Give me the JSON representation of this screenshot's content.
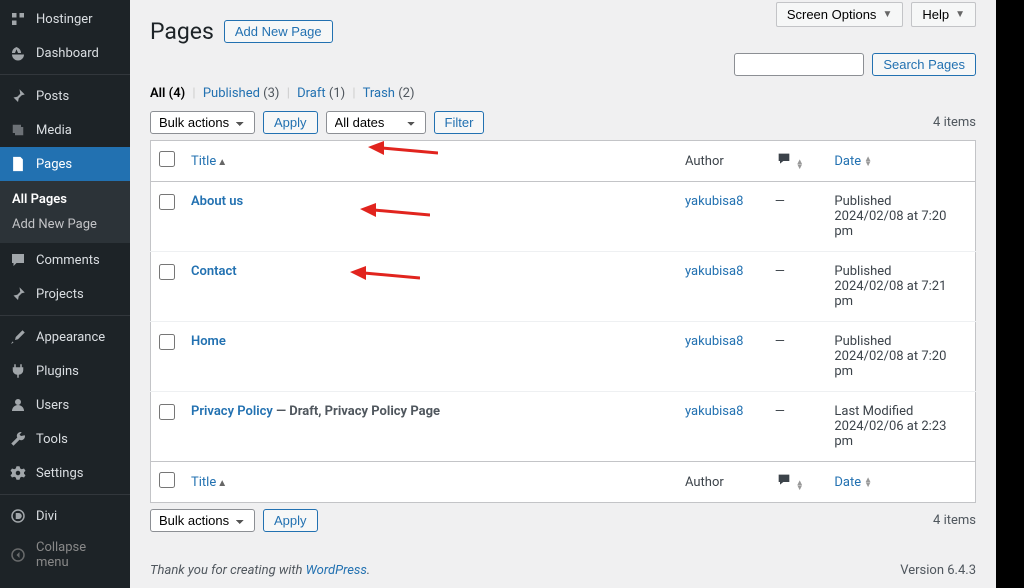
{
  "sidebar": {
    "items": [
      {
        "label": "Hostinger"
      },
      {
        "label": "Dashboard"
      },
      {
        "label": "Posts"
      },
      {
        "label": "Media"
      },
      {
        "label": "Pages"
      },
      {
        "label": "Comments"
      },
      {
        "label": "Projects"
      },
      {
        "label": "Appearance"
      },
      {
        "label": "Plugins"
      },
      {
        "label": "Users"
      },
      {
        "label": "Tools"
      },
      {
        "label": "Settings"
      },
      {
        "label": "Divi"
      },
      {
        "label": "Collapse menu"
      }
    ],
    "submenu": {
      "items": [
        {
          "label": "All Pages"
        },
        {
          "label": "Add New Page"
        }
      ]
    }
  },
  "topActions": {
    "screenOptions": "Screen Options",
    "help": "Help"
  },
  "page": {
    "title": "Pages",
    "addNewLabel": "Add New Page"
  },
  "filters": {
    "all": {
      "label": "All",
      "count": "(4)"
    },
    "published": {
      "label": "Published",
      "count": "(3)"
    },
    "draft": {
      "label": "Draft",
      "count": "(1)"
    },
    "trash": {
      "label": "Trash",
      "count": "(2)"
    }
  },
  "controls": {
    "bulkActions": "Bulk actions",
    "apply": "Apply",
    "allDates": "All dates",
    "filter": "Filter",
    "itemsCount": "4 items",
    "searchPages": "Search Pages",
    "searchValue": ""
  },
  "columns": {
    "title": "Title",
    "author": "Author",
    "date": "Date"
  },
  "rows": [
    {
      "title": "About us",
      "suffix": "",
      "author": "yakubisa8",
      "comments": "—",
      "dateState": "Published",
      "dateLine": "2024/02/08 at 7:20 pm"
    },
    {
      "title": "Contact",
      "suffix": "",
      "author": "yakubisa8",
      "comments": "—",
      "dateState": "Published",
      "dateLine": "2024/02/08 at 7:21 pm"
    },
    {
      "title": "Home",
      "suffix": "",
      "author": "yakubisa8",
      "comments": "—",
      "dateState": "Published",
      "dateLine": "2024/02/08 at 7:20 pm"
    },
    {
      "title": "Privacy Policy",
      "suffix": " — Draft, Privacy Policy Page",
      "author": "yakubisa8",
      "comments": "—",
      "dateState": "Last Modified",
      "dateLine": "2024/02/06 at 2:23 pm"
    }
  ],
  "footer": {
    "thanks": "Thank you for creating with ",
    "wp": "WordPress",
    "period": ".",
    "version": "Version 6.4.3"
  }
}
